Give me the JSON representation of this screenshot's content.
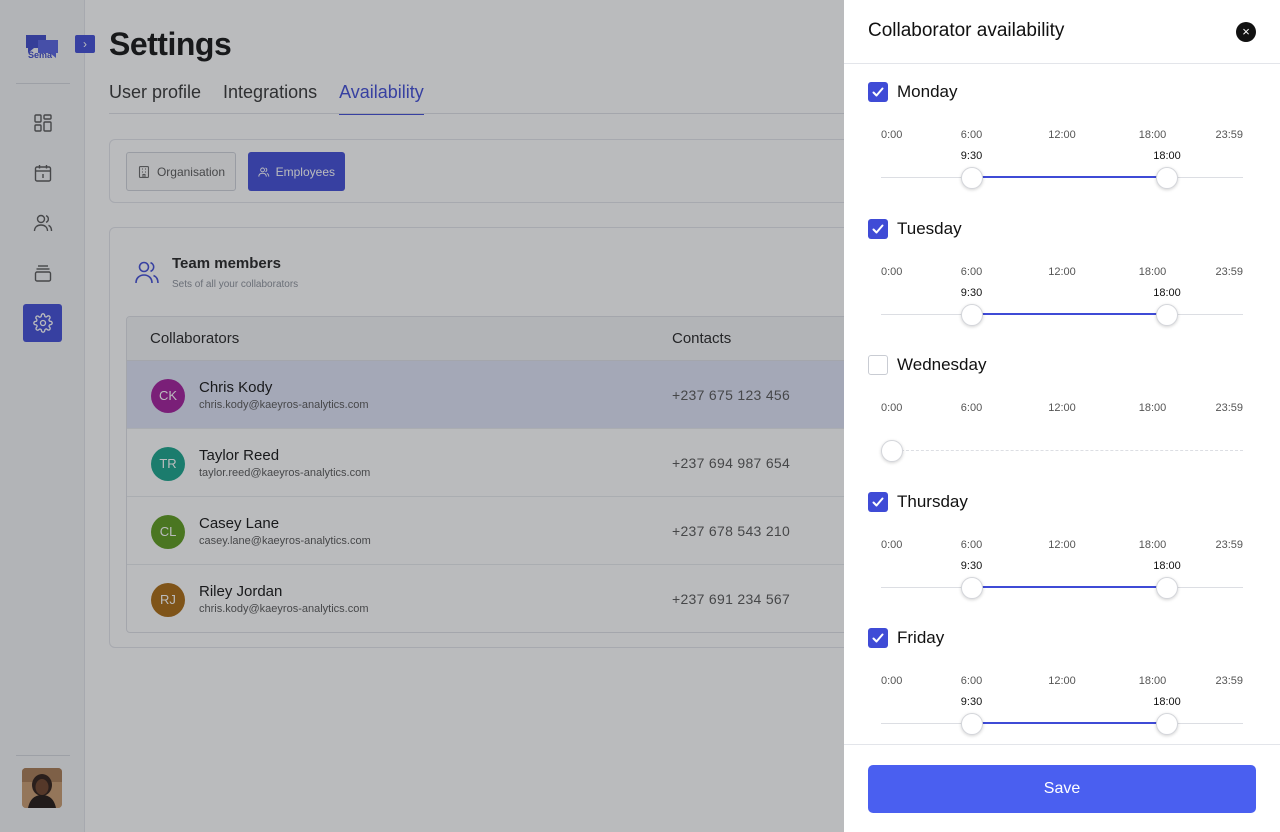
{
  "sidebar": {
    "logo_text": "Sema",
    "expand_icon": "›"
  },
  "main": {
    "title": "Settings",
    "tabs": [
      {
        "label": "User profile",
        "active": false
      },
      {
        "label": "Integrations",
        "active": false
      },
      {
        "label": "Availability",
        "active": true
      }
    ],
    "segment": {
      "organisation": "Organisation",
      "employees": "Employees",
      "active": "Employees"
    },
    "team": {
      "title": "Team members",
      "subtitle": "Sets of all your collaborators",
      "columns": {
        "collaborators": "Collaborators",
        "contacts": "Contacts"
      },
      "rows": [
        {
          "initials": "CK",
          "name": "Chris Kody",
          "email": "chris.kody@kaeyros-analytics.com",
          "phone": "+237 675 123 456",
          "color": "#a11a9a",
          "selected": true
        },
        {
          "initials": "TR",
          "name": "Taylor Reed",
          "email": "taylor.reed@kaeyros-analytics.com",
          "phone": "+237 694 987 654",
          "color": "#16a389",
          "selected": false
        },
        {
          "initials": "CL",
          "name": "Casey Lane",
          "email": "casey.lane@kaeyros-analytics.com",
          "phone": "+237 678 543 210",
          "color": "#5a9a1a",
          "selected": false
        },
        {
          "initials": "RJ",
          "name": "Riley Jordan",
          "email": "chris.kody@kaeyros-analytics.com",
          "phone": "+237 691 234 567",
          "color": "#a8670e",
          "selected": false
        }
      ]
    }
  },
  "panel": {
    "title": "Collaborator availability",
    "close_icon": "×",
    "tick_labels": [
      "0:00",
      "6:00",
      "12:00",
      "18:00",
      "23:59"
    ],
    "days": [
      {
        "name": "Monday",
        "enabled": true,
        "start": "9:30",
        "end": "18:00",
        "start_frac": 0.25,
        "end_frac": 0.79
      },
      {
        "name": "Tuesday",
        "enabled": true,
        "start": "9:30",
        "end": "18:00",
        "start_frac": 0.25,
        "end_frac": 0.79
      },
      {
        "name": "Wednesday",
        "enabled": false,
        "start": "",
        "end": "",
        "start_frac": 0.03,
        "end_frac": 0.03
      },
      {
        "name": "Thursday",
        "enabled": true,
        "start": "9:30",
        "end": "18:00",
        "start_frac": 0.25,
        "end_frac": 0.79
      },
      {
        "name": "Friday",
        "enabled": true,
        "start": "9:30",
        "end": "18:00",
        "start_frac": 0.25,
        "end_frac": 0.79
      }
    ],
    "save_label": "Save"
  },
  "colors": {
    "accent": "#3f4bd6",
    "save": "#4a5ff0"
  }
}
